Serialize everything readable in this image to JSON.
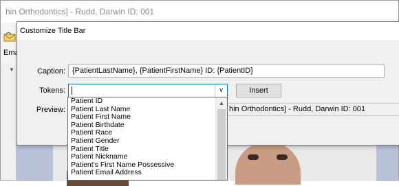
{
  "background_window": {
    "title": "hin Orthodontics] - Rudd, Darwin  ID: 001",
    "toolbar": {
      "label": "Ema",
      "icon": "envelope-icon"
    }
  },
  "dialog": {
    "title": "Customize Title Bar",
    "caption_label": "Caption:",
    "caption_value": "{PatientLastName}, {PatientFirstName}  ID: {PatientID}",
    "tokens_label": "Tokens:",
    "tokens_value": "",
    "insert_label": "Insert",
    "preview_label": "Preview:",
    "preview_value": "hin Orthodontics] - Rudd, Darwin  ID: 001"
  },
  "tokens_dropdown": {
    "items": [
      "Patient ID",
      "Patient Last Name",
      "Patient First Name",
      "Patient Birthdate",
      "Patient Race",
      "Patient Gender",
      "Patient Title",
      "Patient Nickname",
      "Patient's First Name Possessive",
      "Patient Email Address"
    ]
  },
  "colors": {
    "focus_border": "#0078d7",
    "image_panel": "#b9c2d8"
  }
}
